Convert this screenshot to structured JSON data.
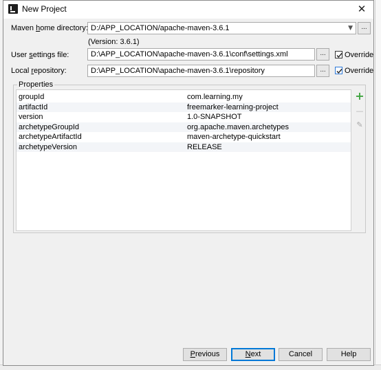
{
  "window": {
    "title": "New Project",
    "close_glyph": "✕"
  },
  "maven_home": {
    "label_pre": "Maven ",
    "label_u": "h",
    "label_post": "ome directory:",
    "value": "D:/APP_LOCATION/apache-maven-3.6.1",
    "version": "(Version: 3.6.1)"
  },
  "user_settings": {
    "label_pre": "User ",
    "label_u": "s",
    "label_post": "ettings file:",
    "value": "D:\\APP_LOCATION\\apache-maven-3.6.1\\conf\\settings.xml",
    "override_label": "Override",
    "override_checked": true
  },
  "local_repo": {
    "label_pre": "Local ",
    "label_u": "r",
    "label_post": "epository:",
    "value": "D:\\APP_LOCATION\\apache-maven-3.6.1\\repository",
    "override_label": "Override",
    "override_checked": true
  },
  "browse_label": "...",
  "properties": {
    "title": "Properties",
    "rows": [
      {
        "key": "groupId",
        "value": "com.learning.my"
      },
      {
        "key": "artifactId",
        "value": "freemarker-learning-project"
      },
      {
        "key": "version",
        "value": "1.0-SNAPSHOT"
      },
      {
        "key": "archetypeGroupId",
        "value": "org.apache.maven.archetypes"
      },
      {
        "key": "archetypeArtifactId",
        "value": "maven-archetype-quickstart"
      },
      {
        "key": "archetypeVersion",
        "value": "RELEASE"
      }
    ],
    "tools": {
      "add": "+",
      "remove": "—",
      "edit": "✎"
    }
  },
  "buttons": {
    "previous_u": "P",
    "previous_post": "revious",
    "next_u": "N",
    "next_post": "ext",
    "cancel": "Cancel",
    "help": "Help"
  },
  "colors": {
    "accent": "#0078d7",
    "add_icon": "#3fa33f"
  }
}
